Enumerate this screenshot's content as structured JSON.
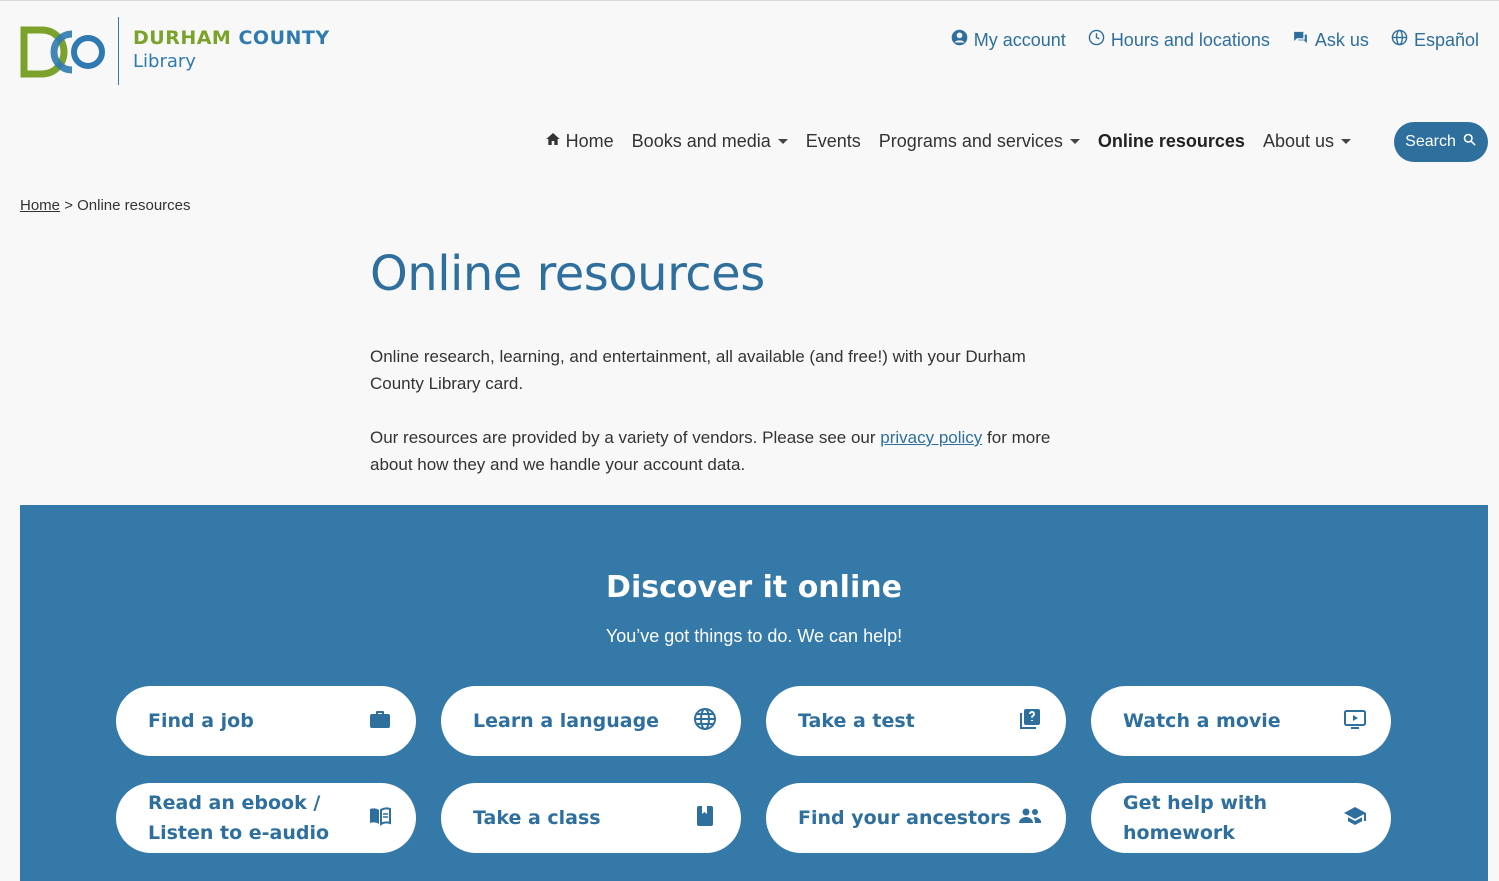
{
  "logo": {
    "brand_top_part1": "DURHAM",
    "brand_top_part2": "COUNTY",
    "brand_bottom": "Library"
  },
  "util_nav": [
    {
      "label": "My account",
      "icon": "account-icon"
    },
    {
      "label": "Hours and locations",
      "icon": "clock-icon"
    },
    {
      "label": "Ask us",
      "icon": "chat-icon"
    },
    {
      "label": "Español",
      "icon": "globe-icon"
    }
  ],
  "main_nav": {
    "home": "Home",
    "books": "Books and media",
    "events": "Events",
    "programs": "Programs and services",
    "online": "Online resources",
    "about": "About us"
  },
  "search": {
    "label": "Search"
  },
  "breadcrumb": {
    "home": "Home",
    "separator": ">",
    "current": "Online resources"
  },
  "page": {
    "title": "Online resources",
    "intro1": "Online research, learning, and entertainment, all available (and free!) with your Durham County Library card.",
    "intro2_before": "Our resources are provided by a variety of vendors. Please see our ",
    "intro2_link": "privacy policy",
    "intro2_after": " for more about how they and we handle your account data."
  },
  "discover": {
    "title": "Discover it online",
    "subtitle": "You’ve got things to do. We can help!",
    "tiles": [
      {
        "label": "Find a job",
        "icon": "briefcase-icon"
      },
      {
        "label": "Learn a language",
        "icon": "globe-icon"
      },
      {
        "label": "Take a test",
        "icon": "quiz-icon"
      },
      {
        "label": "Watch a movie",
        "icon": "play-screen-icon"
      },
      {
        "label": "Read an ebook /\nListen to e-audio",
        "icon": "book-open-icon"
      },
      {
        "label": "Take a class",
        "icon": "notebook-icon"
      },
      {
        "label": "Find your ancestors",
        "icon": "people-icon"
      },
      {
        "label": "Get help with\nhomework",
        "icon": "graduation-cap-icon"
      }
    ]
  },
  "colors": {
    "primary": "#2e6f9e",
    "band": "#3479a8",
    "logo_green": "#7ba22a",
    "logo_blue": "#2f7ab0"
  }
}
